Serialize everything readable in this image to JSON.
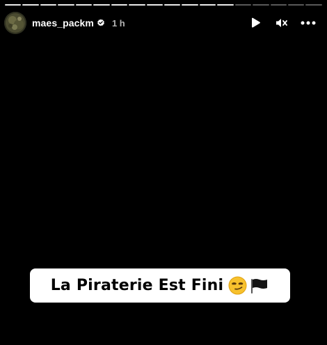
{
  "story": {
    "username": "maes_packm",
    "time_ago": "1 h",
    "caption": "La Piraterie Est Fini",
    "caption_emojis": [
      "smirk-emoji",
      "black-flag-emoji"
    ],
    "progress_segments": 18,
    "progress_completed": 13
  },
  "colors": {
    "background": "#000000",
    "caption_bg": "#ffffff",
    "text": "#ffffff"
  },
  "icons": {
    "play": "play-icon",
    "mute": "speaker-muted-icon",
    "more": "more-icon",
    "verified": "verified-badge-icon"
  }
}
